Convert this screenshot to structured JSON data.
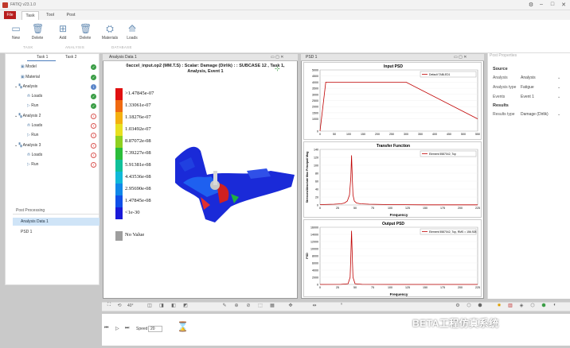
{
  "app": {
    "title": "FATIQ v23.1.0"
  },
  "menu": {
    "file": "File",
    "tabs": [
      "Task",
      "Tool",
      "Post"
    ]
  },
  "ribbon": {
    "buttons": [
      "New",
      "Delete",
      "Add",
      "Delete",
      "Materials",
      "Loads"
    ],
    "groups": [
      "TASK",
      "ANALYSIS",
      "DATABASE"
    ]
  },
  "left_panel": {
    "tabs": [
      "Task 1",
      "Task 2"
    ],
    "tree": [
      {
        "label": "Model",
        "status": "ok"
      },
      {
        "label": "Material",
        "status": "ok"
      },
      {
        "label": "Analysis",
        "status": "info"
      },
      {
        "label": "Loads",
        "status": "ok"
      },
      {
        "label": "Run",
        "status": "ok"
      },
      {
        "label": "Analysis 2",
        "status": "err"
      },
      {
        "label": "Loads",
        "status": "err"
      },
      {
        "label": "Run",
        "status": "err"
      },
      {
        "label": "Analysis 3",
        "status": "err"
      },
      {
        "label": "Loads",
        "status": "err"
      },
      {
        "label": "Run",
        "status": "err"
      }
    ],
    "post_processing": {
      "title": "Post Processing",
      "items": [
        "Analysis Data 1",
        "PSD 1"
      ]
    }
  },
  "analysis_view": {
    "title": "Analysis Data 1",
    "info_line1": "0accel_input.op2 (MM.T.S)  : Scalar: Damage (Dirlik) :  : SUBCASE 12  , Task 1,",
    "info_line2": "Analysis, Event 1",
    "legend": [
      {
        "label": ">1.47845e-07",
        "color": "#e01010"
      },
      {
        "label": "1.33061e-07",
        "color": "#f06a10"
      },
      {
        "label": "1.18276e-07",
        "color": "#f4b010"
      },
      {
        "label": "1.03492e-07",
        "color": "#e8e020"
      },
      {
        "label": "8.87072e-08",
        "color": "#8fd020"
      },
      {
        "label": "7.39227e-08",
        "color": "#2bbd3a"
      },
      {
        "label": "5.91381e-08",
        "color": "#10c09a"
      },
      {
        "label": "4.43536e-08",
        "color": "#10b8d8"
      },
      {
        "label": "2.95690e-08",
        "color": "#1088e8"
      },
      {
        "label": "1.47845e-08",
        "color": "#1050e8"
      },
      {
        "label": "<1e-30",
        "color": "#1a1ad8"
      }
    ],
    "no_value": "No Value"
  },
  "psd_window": {
    "title": "PSD 1"
  },
  "chart_data": [
    {
      "type": "line",
      "title": "Input PSD",
      "xlabel": "",
      "ylabel": "",
      "xlim": [
        0,
        550
      ],
      "ylim": [
        0,
        5000
      ],
      "xticks": [
        0,
        50,
        100,
        150,
        200,
        250,
        300,
        350,
        400,
        450,
        500,
        550
      ],
      "yticks": [
        0,
        1000,
        1500,
        2000,
        2500,
        3000,
        3500,
        4000,
        4500,
        5000
      ],
      "series": [
        {
          "name": "Default TABLED1",
          "color": "#c00000",
          "x": [
            0,
            20,
            300,
            550
          ],
          "y": [
            0,
            4000,
            4000,
            1000
          ]
        }
      ]
    },
    {
      "type": "line",
      "title": "Transfer Function",
      "xlabel": "Frequency",
      "ylabel": "Stresses/Absolute Max Principal/ Mag",
      "xlim": [
        0,
        225
      ],
      "ylim": [
        0,
        140
      ],
      "xticks": [
        0,
        25,
        50,
        75,
        100,
        125,
        150,
        175,
        200,
        225
      ],
      "yticks": [
        0,
        20,
        40,
        60,
        80,
        100,
        120,
        140
      ],
      "series": [
        {
          "name": "Element 5587042, Top",
          "color": "#c00000",
          "x": [
            0,
            20,
            30,
            35,
            39,
            42,
            44,
            45,
            46,
            47,
            49,
            52,
            58,
            70,
            100,
            150,
            225
          ],
          "y": [
            1,
            2,
            3,
            5,
            10,
            25,
            70,
            125,
            70,
            25,
            10,
            5,
            3,
            2,
            1,
            0.5,
            0.3
          ]
        }
      ]
    },
    {
      "type": "line",
      "title": "Output PSD",
      "xlabel": "Frequency",
      "ylabel": "PSD",
      "xlim": [
        0,
        225
      ],
      "ylim": [
        0,
        16000
      ],
      "xticks": [
        0,
        25,
        50,
        75,
        100,
        125,
        150,
        175,
        200,
        225
      ],
      "yticks": [
        0,
        2000,
        4000,
        6000,
        8000,
        10000,
        12000,
        14000,
        16000
      ],
      "series": [
        {
          "name": "Element 5587042, Top, RMS = 156.928",
          "color": "#c00000",
          "x": [
            0,
            30,
            40,
            43,
            44,
            45,
            46,
            47,
            50,
            60,
            100,
            225
          ],
          "y": [
            0,
            20,
            200,
            2000,
            8000,
            15000,
            8000,
            2000,
            200,
            20,
            0,
            0
          ]
        }
      ]
    }
  ],
  "properties": {
    "title": "Post Properties",
    "source_header": "Source",
    "source": [
      {
        "label": "Analysis",
        "value": "Analysis"
      },
      {
        "label": "Analysis type",
        "value": "Fatigue"
      },
      {
        "label": "Events",
        "value": "Event 1"
      }
    ],
    "results_header": "Results",
    "results": [
      {
        "label": "Results type",
        "value": "Damage (Dirlik)"
      }
    ]
  },
  "bottom": {
    "zoom": "40°",
    "speed_label": "Speed",
    "speed_value": "20"
  },
  "watermark": "BETA工程仿真系统"
}
